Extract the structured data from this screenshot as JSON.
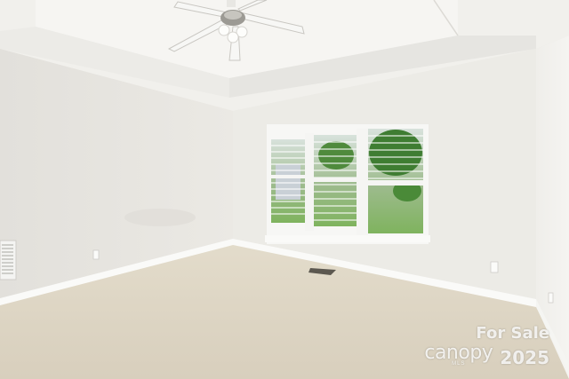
{
  "photo": {
    "colors": {
      "wall_left": "#e7e5e0",
      "wall_back": "#ecebe6",
      "wall_right": "#eeede9",
      "ceiling": "#f1f0ec",
      "carpet": "#ddd5c3",
      "trim": "#fafaf8",
      "window_glass": "#9fb596",
      "lawn": "#7fb35e",
      "tree": "#3f7d32"
    },
    "icons": [
      "ceiling-fan-icon",
      "air-vent-icon",
      "floor-register-icon",
      "electrical-outlet-icon"
    ]
  },
  "watermark": {
    "line1": "For Sale",
    "brand": "canopy",
    "brand_sub": "MLS",
    "year": "2025"
  }
}
